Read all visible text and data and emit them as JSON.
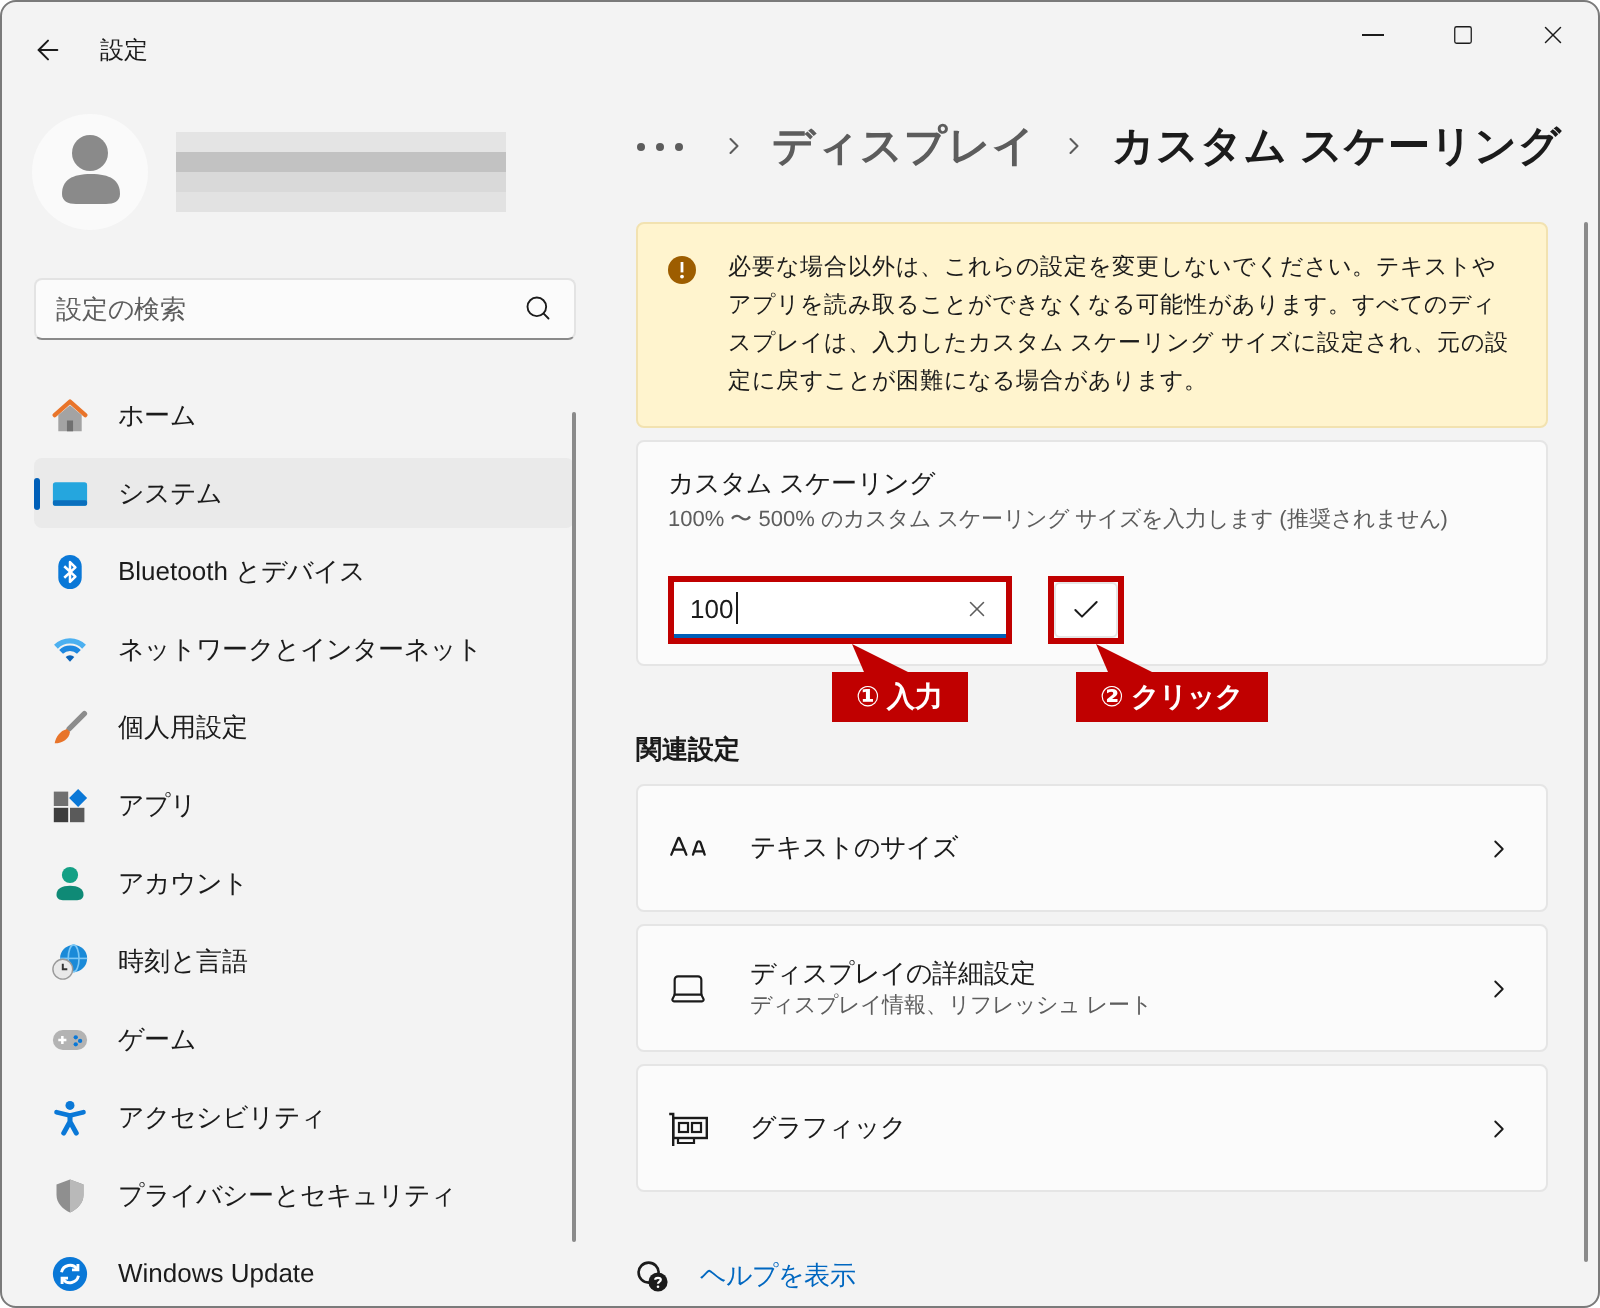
{
  "window": {
    "title": "設定"
  },
  "search": {
    "placeholder": "設定の検索"
  },
  "sidebar": {
    "items": [
      {
        "label": "ホーム",
        "selected": false
      },
      {
        "label": "システム",
        "selected": true
      },
      {
        "label": "Bluetooth とデバイス",
        "selected": false
      },
      {
        "label": "ネットワークとインターネット",
        "selected": false
      },
      {
        "label": "個人用設定",
        "selected": false
      },
      {
        "label": "アプリ",
        "selected": false
      },
      {
        "label": "アカウント",
        "selected": false
      },
      {
        "label": "時刻と言語",
        "selected": false
      },
      {
        "label": "ゲーム",
        "selected": false
      },
      {
        "label": "アクセシビリティ",
        "selected": false
      },
      {
        "label": "プライバシーとセキュリティ",
        "selected": false
      },
      {
        "label": "Windows Update",
        "selected": false
      }
    ]
  },
  "breadcrumb": {
    "items": [
      {
        "label": "ディスプレイ",
        "current": false
      },
      {
        "label": "カスタム スケーリング",
        "current": true
      }
    ]
  },
  "warning": {
    "text": "必要な場合以外は、これらの設定を変更しないでください。テキストやアプリを読み取ることができなくなる可能性があります。すべてのディスプレイは、入力したカスタム スケーリング サイズに設定され、元の設定に戻すことが困難になる場合があります。"
  },
  "custom_scaling": {
    "title": "カスタム スケーリング",
    "description": "100% 〜 500% のカスタム スケーリング サイズを入力します (推奨されません)",
    "value": "100",
    "focused": true
  },
  "annotations": [
    {
      "label": "① 入力"
    },
    {
      "label": "② クリック"
    }
  ],
  "related": {
    "heading": "関連設定",
    "items": [
      {
        "label": "テキストのサイズ"
      },
      {
        "label": "ディスプレイの詳細設定",
        "description": "ディスプレイ情報、リフレッシュ レート"
      },
      {
        "label": "グラフィック"
      }
    ]
  },
  "help": {
    "label": "ヘルプを表示"
  }
}
